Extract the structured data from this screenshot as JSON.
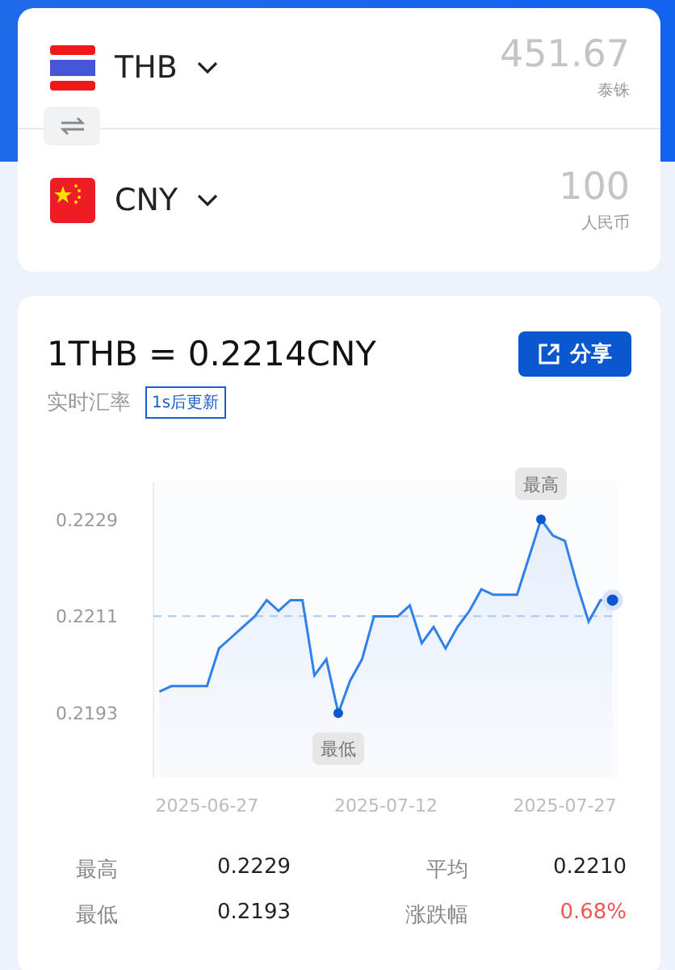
{
  "converter": {
    "from": {
      "code": "THB",
      "amount": "451.67",
      "name": "泰铢",
      "kind": "thailand"
    },
    "to": {
      "code": "CNY",
      "amount": "100",
      "name": "人民币",
      "kind": "china"
    }
  },
  "rate": {
    "title": "1THB = 0.2214CNY",
    "share": "分享",
    "subtitle": "实时汇率",
    "badge": "1s后更新"
  },
  "chart": {
    "chart_data": {
      "type": "area",
      "categories": [
        null,
        null,
        null,
        null,
        "2025-06-27",
        null,
        null,
        null,
        null,
        null,
        null,
        null,
        null,
        null,
        null,
        null,
        null,
        null,
        null,
        "2025-07-12",
        null,
        null,
        null,
        null,
        null,
        null,
        null,
        null,
        null,
        null,
        null,
        null,
        null,
        null,
        "2025-07-27",
        null,
        null,
        null,
        null
      ],
      "series": [
        {
          "color": "#2f80ed",
          "values": [
            0.2197,
            0.2198,
            0.2198,
            0.2198,
            0.2198,
            0.2205,
            0.2207,
            0.2209,
            0.2211,
            0.2214,
            0.2212,
            0.2214,
            0.2214,
            0.22,
            0.2203,
            0.2193,
            0.2199,
            0.2203,
            0.2211,
            0.2211,
            0.2211,
            0.2213,
            0.2206,
            0.2209,
            0.2205,
            0.2209,
            0.2212,
            0.2216,
            0.2215,
            0.2215,
            0.2215,
            0.2222,
            0.2229,
            0.2226,
            0.2225,
            0.2217,
            0.221,
            0.2214,
            0.2214
          ]
        }
      ],
      "ylim": [
        0.2181,
        0.2236
      ],
      "yticks": [
        {
          "value": 0.2229,
          "label": "0.2229"
        },
        {
          "value": 0.2211,
          "label": "0.2211"
        },
        {
          "value": 0.2193,
          "label": "0.2193"
        }
      ],
      "ref_lines": [
        {
          "axis": "y",
          "value": 0.2211
        }
      ],
      "annotations": [
        {
          "text": "最高",
          "y": 0.2229
        },
        {
          "text": "最低",
          "y": 0.2193
        }
      ]
    }
  },
  "stats": [
    {
      "label": "最高",
      "value": "0.2229",
      "color": "#222222"
    },
    {
      "label": "平均",
      "value": "0.2210",
      "color": "#222222"
    },
    {
      "label": "最低",
      "value": "0.2193",
      "color": "#222222"
    },
    {
      "label": "涨跌幅",
      "value": "0.68%",
      "color": "#f25555"
    }
  ]
}
